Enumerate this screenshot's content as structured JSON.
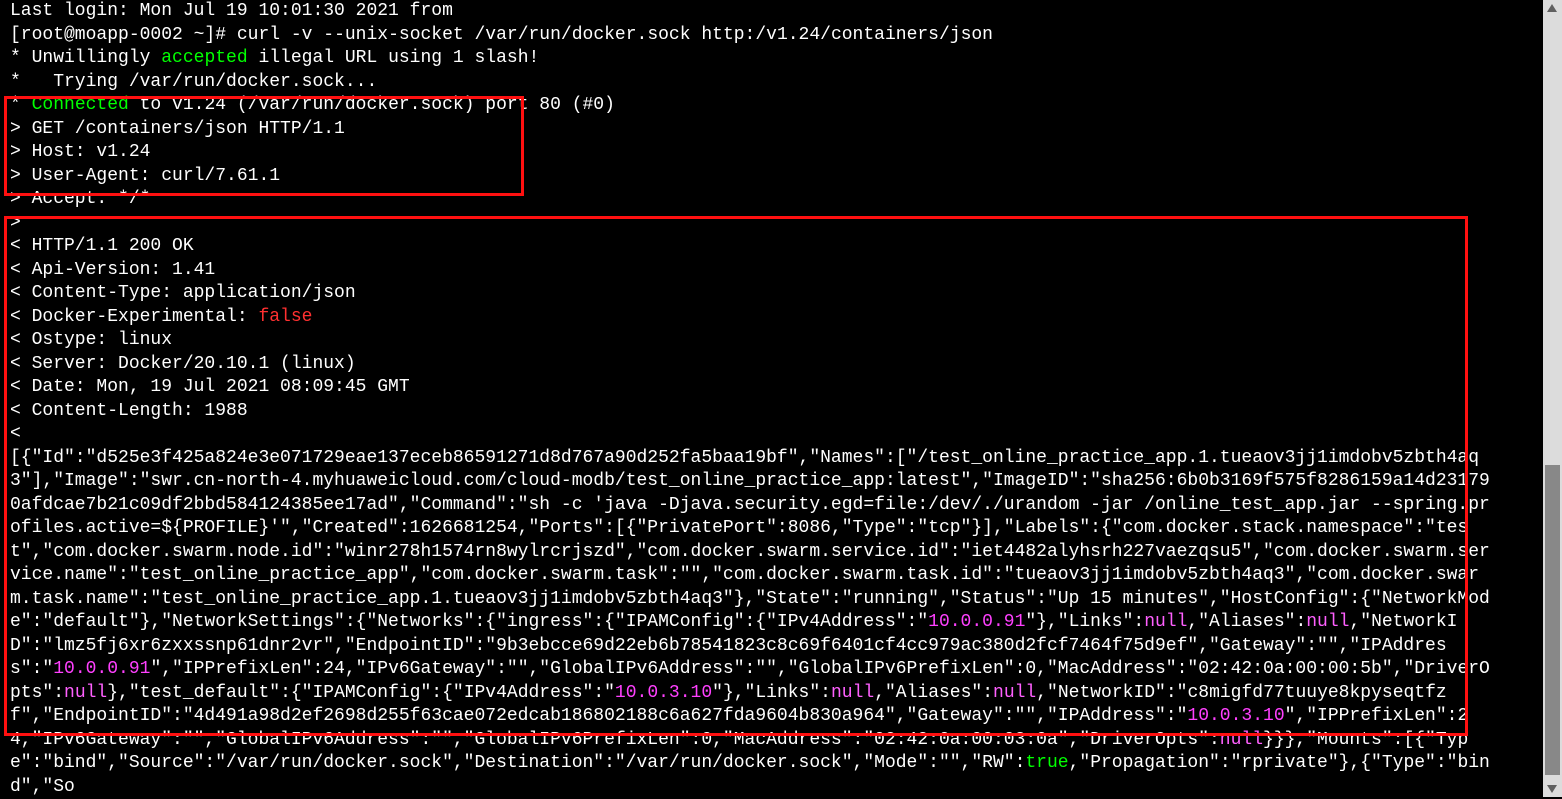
{
  "terminal": {
    "login_prefix": "Last login: Mon Jul 19 10:01:30 2021 from",
    "login_ip": "",
    "prompt_user": "[root@moapp-0002 ~]#",
    "command": "curl -v --unix-socket /var/run/docker.sock http:/v1.24/containers/json",
    "line2_pre": "* Unwillingly ",
    "line2_accepted": "accepted",
    "line2_post": " illegal URL using 1 slash!",
    "line3": "*   Trying /var/run/docker.sock...",
    "line4_star": "* ",
    "line4_connected": "Connected",
    "line4_post": " to v1.24 (/var/run/docker.sock) port 80 (#0)",
    "req": {
      "l1": "> GET /containers/json HTTP/1.1",
      "l2": "> Host: v1.24",
      "l3": "> User-Agent: curl/7.61.1",
      "l4": "> Accept: */*",
      "l5": ">"
    },
    "resp": {
      "l1": "< HTTP/1.1 200 OK",
      "l2": "< Api-Version: 1.41",
      "l3": "< Content-Type: application/json",
      "l4_pre": "< Docker-Experimental: ",
      "l4_false": "false",
      "l5": "< Ostype: linux",
      "l6": "< Server: Docker/20.10.1 (linux)",
      "l7": "< Date: Mon, 19 Jul 2021 08:09:45 GMT",
      "l8": "< Content-Length: 1988",
      "l9": "<"
    },
    "json": {
      "s1": "[{\"Id\":\"d525e3f425a824e3e071729eae137eceb86591271d8d767a90d252fa5baa19bf\",\"Names\":[\"/test_online_practice_app.1.tueaov3jj1imdobv5zbth4aq3\"],\"Image\":\"swr.cn-north-4.myhuaweicloud.com/cloud-modb/test_online_practice_app:latest\",\"ImageID\":\"sha256:6b0b3169f575f8286159a14d231790afdcae7b21c09df2bbd584124385ee17ad\",\"Command\":\"sh -c 'java -Djava.security.egd=file:/dev/./urandom -jar /online_test_app.jar --spring.profiles.active=${PROFILE}'\",\"Created\":1626681254,\"Ports\":[{\"PrivatePort\":8086,\"Type\":\"tcp\"}],\"Labels\":{\"com.docker.stack.namespace\":\"test\",\"com.docker.swarm.node.id\":\"winr278h1574rn8wylrcrjszd\",\"com.docker.swarm.service.id\":\"iet4482alyhsrh227vaezqsu5\",\"com.docker.swarm.service.name\":\"test_online_practice_app\",\"com.docker.swarm.task\":\"\",\"com.docker.swarm.task.id\":\"tueaov3jj1imdobv5zbth4aq3\",\"com.docker.swarm.task.name\":\"test_online_practice_app.1.tueaov3jj1imdobv5zbth4aq3\"},\"State\":\"running\",\"Status\":\"Up 15 minutes\",\"HostConfig\":{\"NetworkMode\":\"default\"},\"NetworkSettings\":{\"Networks\":{\"ingress\":{\"IPAMConfig\":{\"IPv4Address\":\"",
      "ip1": "10.0.0.91",
      "s2": "\"},\"Links\":",
      "null1": "null",
      "s3": ",\"Aliases\":",
      "null2": "null",
      "s4": ",\"NetworkID\":\"lmz5fj6xr6zxxssnp61dnr2vr\",\"EndpointID\":\"9b3ebcce69d22eb6b78541823c8c69f6401cf4cc979ac380d2fcf7464f75d9ef\",\"Gateway\":\"\",\"IPAddress\":\"",
      "ip2": "10.0.0.91",
      "s5": "\",\"IPPrefixLen\":24,\"IPv6Gateway\":\"\",\"GlobalIPv6Address\":\"\",\"GlobalIPv6PrefixLen\":0,\"MacAddress\":\"02:42:0a:00:00:5b\",\"DriverOpts\":",
      "null3": "null",
      "s6": "},\"test_default\":{\"IPAMConfig\":{\"IPv4Address\":\"",
      "ip3": "10.0.3.10",
      "s7": "\"},\"Links\":",
      "null4": "null",
      "s8": ",\"Aliases\":",
      "null5": "null",
      "s9": ",\"NetworkID\":\"c8migfd77tuuye8kpyseqtfzf\",\"EndpointID\":\"4d491a98d2ef2698d255f63cae072edcab186802188c6a627fda9604b830a964\",\"Gateway\":\"\",\"IPAddress\":\"",
      "ip4": "10.0.3.10",
      "s10": "\",\"IPPrefixLen\":24,\"IPv6Gateway\":\"\",\"GlobalIPv6Address\":\"\",\"GlobalIPv6PrefixLen\":0,\"MacAddress\":\"02:42:0a:00:03:0a\",\"DriverOpts\":",
      "null6": "null",
      "s11": "}}},\"Mounts\":[{\"Type\":\"bind\",\"Source\":\"/var/run/docker.sock\",\"Destination\":\"/var/run/docker.sock\",\"Mode\":\"\",\"RW\":",
      "true1": "true",
      "s12": ",\"Propagation\":\"rprivate\"},{\"Type\":\"bind\",\"So"
    }
  }
}
